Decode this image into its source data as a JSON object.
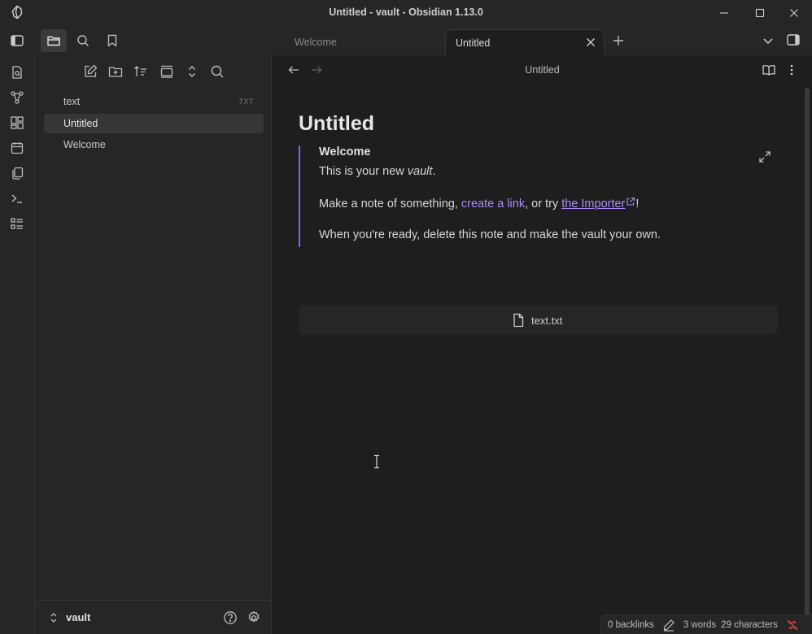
{
  "window": {
    "title": "Untitled - vault - Obsidian 1.13.0"
  },
  "tabs": [
    {
      "label": "Welcome",
      "active": false
    },
    {
      "label": "Untitled",
      "active": true
    }
  ],
  "explorer": {
    "files": [
      {
        "name": "text",
        "ext": "TXT",
        "selected": false
      },
      {
        "name": "Untitled",
        "ext": "",
        "selected": true
      },
      {
        "name": "Welcome",
        "ext": "",
        "selected": false
      }
    ],
    "vault_name": "vault"
  },
  "editor": {
    "view_title": "Untitled",
    "note_title": "Untitled",
    "embed": {
      "heading": "Welcome",
      "line1_prefix": "This is your new ",
      "line1_italic": "vault",
      "line1_suffix": ".",
      "line2_prefix": "Make a note of something, ",
      "line2_internal_link": "create a link",
      "line2_middle": ", or try ",
      "line2_external_link": "the Importer",
      "line2_suffix": "!",
      "line3": "When you're ready, delete this note and make the vault your own."
    },
    "attachment": {
      "filename": "text.txt"
    }
  },
  "statusbar": {
    "backlinks": "0 backlinks",
    "words": "3 words",
    "characters": "29 characters"
  },
  "colors": {
    "accent": "#8a5cf5",
    "link": "#a88bfa",
    "background": "#1e1e1e",
    "panel": "#262626",
    "sync_error": "#e0474c"
  }
}
